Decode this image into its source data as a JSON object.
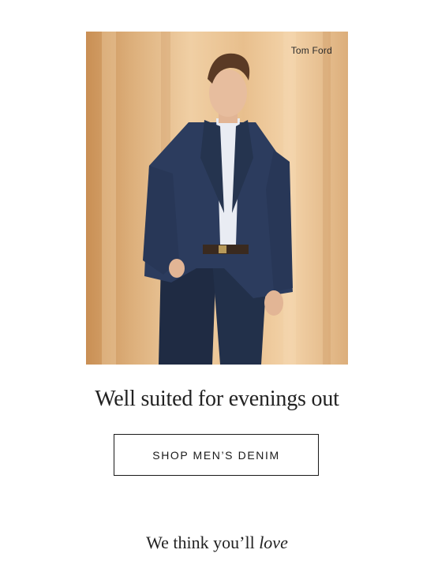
{
  "hero": {
    "brand_label": "Tom Ford",
    "image_description_icon": "model-in-denim-blazer",
    "colors": {
      "backdrop": "#e8bf8d",
      "jacket": "#2a3a5c",
      "shirt": "#e9ecf3",
      "skin": "#e2b595",
      "hair": "#5a3a25"
    }
  },
  "headline": "Well suited for evenings out",
  "cta": {
    "label": "SHOP MEN’S DENIM"
  },
  "section": {
    "title_prefix": "We think you’ll ",
    "title_emphasis": "love"
  }
}
